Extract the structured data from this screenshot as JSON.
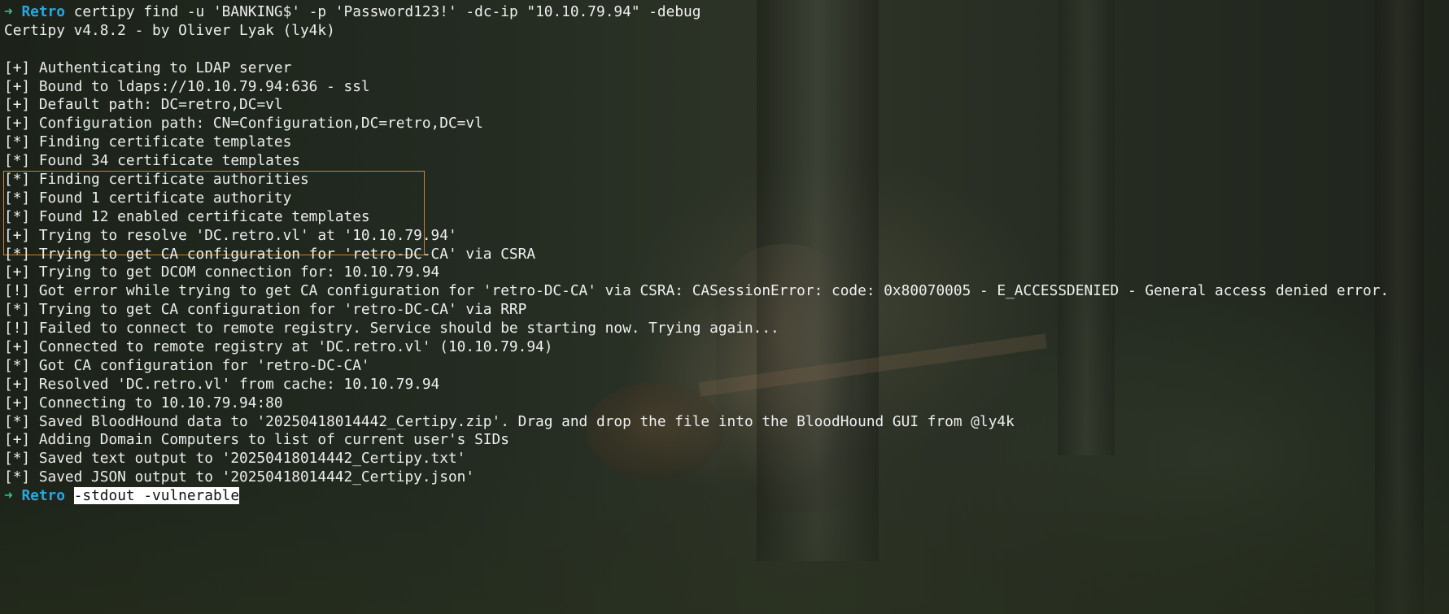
{
  "prompt": {
    "arrow": "➜",
    "name": "Retro"
  },
  "command": "certipy find -u 'BANKING$' -p 'Password123!' -dc-ip \"10.10.79.94\" -debug",
  "banner": "Certipy v4.8.2 - by Oliver Lyak (ly4k)",
  "output_lines": [
    "[+] Authenticating to LDAP server",
    "[+] Bound to ldaps://10.10.79.94:636 - ssl",
    "[+] Default path: DC=retro,DC=vl",
    "[+] Configuration path: CN=Configuration,DC=retro,DC=vl",
    "[*] Finding certificate templates",
    "[*] Found 34 certificate templates",
    "[*] Finding certificate authorities",
    "[*] Found 1 certificate authority",
    "[*] Found 12 enabled certificate templates",
    "[+] Trying to resolve 'DC.retro.vl' at '10.10.79.94'",
    "[*] Trying to get CA configuration for 'retro-DC-CA' via CSRA",
    "[+] Trying to get DCOM connection for: 10.10.79.94",
    "[!] Got error while trying to get CA configuration for 'retro-DC-CA' via CSRA: CASessionError: code: 0x80070005 - E_ACCESSDENIED - General access denied error.",
    "[*] Trying to get CA configuration for 'retro-DC-CA' via RRP",
    "[!] Failed to connect to remote registry. Service should be starting now. Trying again...",
    "[+] Connected to remote registry at 'DC.retro.vl' (10.10.79.94)",
    "[*] Got CA configuration for 'retro-DC-CA'",
    "[+] Resolved 'DC.retro.vl' from cache: 10.10.79.94",
    "[+] Connecting to 10.10.79.94:80",
    "[*] Saved BloodHound data to '20250418014442_Certipy.zip'. Drag and drop the file into the BloodHound GUI from @ly4k",
    "[+] Adding Domain Computers to list of current user's SIDs",
    "[*] Saved text output to '20250418014442_Certipy.txt'",
    "[*] Saved JSON output to '20250418014442_Certipy.json'"
  ],
  "current_input": "-stdout -vulnerable",
  "colors": {
    "prompt_arrow": "#2ec27e",
    "prompt_name": "#29a8e0",
    "text": "#eeeeee",
    "highlight_box": "#c8832c",
    "input_selection_bg": "#ffffff"
  }
}
